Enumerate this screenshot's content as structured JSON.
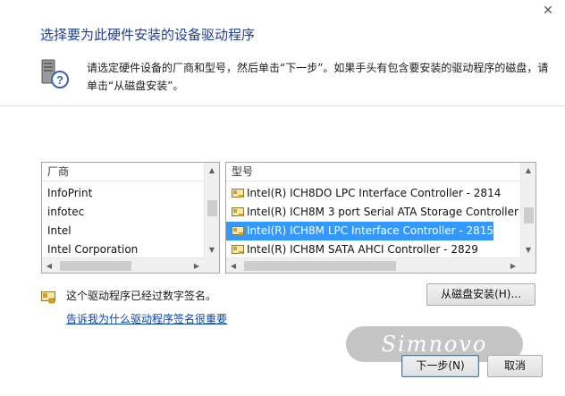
{
  "window": {
    "close_glyph": "✕"
  },
  "header": {
    "title": "选择要为此硬件安装的设备驱动程序",
    "description": "请选定硬件设备的厂商和型号，然后单击“下一步”。如果手头有包含要安装的驱动程序的磁盘，请单击“从磁盘安装”。"
  },
  "manufacturer_list": {
    "header": "厂商",
    "items": [
      "InfoPrint",
      "infotec",
      "Intel",
      "Intel Corporation"
    ]
  },
  "model_list": {
    "header": "型号",
    "items": [
      {
        "label": "Intel(R) ICH8DO LPC Interface Controller - 2814",
        "selected": false
      },
      {
        "label": "Intel(R) ICH8M 3 port Serial ATA Storage Controller -",
        "selected": false
      },
      {
        "label": "Intel(R) ICH8M LPC Interface Controller - 2815",
        "selected": true
      },
      {
        "label": "Intel(R) ICH8M SATA AHCI Controller - 2829",
        "selected": false
      }
    ]
  },
  "signature": {
    "text": "这个驱动程序已经过数字签名。",
    "link": "告诉我为什么驱动程序签名很重要"
  },
  "buttons": {
    "have_disk": "从磁盘安装(H)...",
    "next": "下一步(N)",
    "cancel": "取消"
  },
  "watermark": {
    "text": "Simnovo"
  },
  "colors": {
    "title": "#1f3f8f",
    "selection": "#3399ff",
    "link": "#0645ad"
  }
}
